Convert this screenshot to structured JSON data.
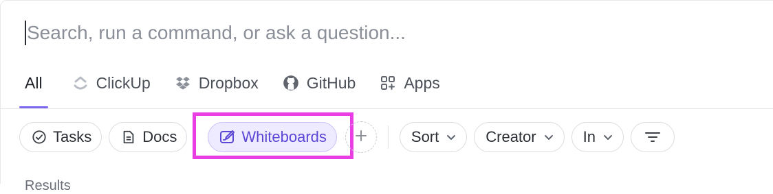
{
  "search": {
    "placeholder": "Search, run a command, or ask a question..."
  },
  "tabs": [
    {
      "label": "All",
      "icon": "none",
      "active": true
    },
    {
      "label": "ClickUp",
      "icon": "clickup-logo-icon"
    },
    {
      "label": "Dropbox",
      "icon": "dropbox-icon"
    },
    {
      "label": "GitHub",
      "icon": "github-icon"
    },
    {
      "label": "Apps",
      "icon": "apps-grid-icon"
    }
  ],
  "chips": {
    "tasks": {
      "label": "Tasks",
      "icon": "check-circle-icon"
    },
    "docs": {
      "label": "Docs",
      "icon": "document-icon"
    },
    "whiteboards": {
      "label": "Whiteboards",
      "icon": "whiteboard-pen-icon",
      "selected": true
    },
    "add": {
      "icon": "plus-icon"
    },
    "sort": {
      "label": "Sort"
    },
    "creator": {
      "label": "Creator"
    },
    "in": {
      "label": "In"
    },
    "filter": {
      "icon": "filter-lines-icon"
    }
  },
  "results_heading": "Results",
  "colors": {
    "accent": "#7b68ee",
    "highlight": "#e83ee3",
    "selected_bg": "#eeeaff",
    "selected_text": "#5b47d6"
  }
}
